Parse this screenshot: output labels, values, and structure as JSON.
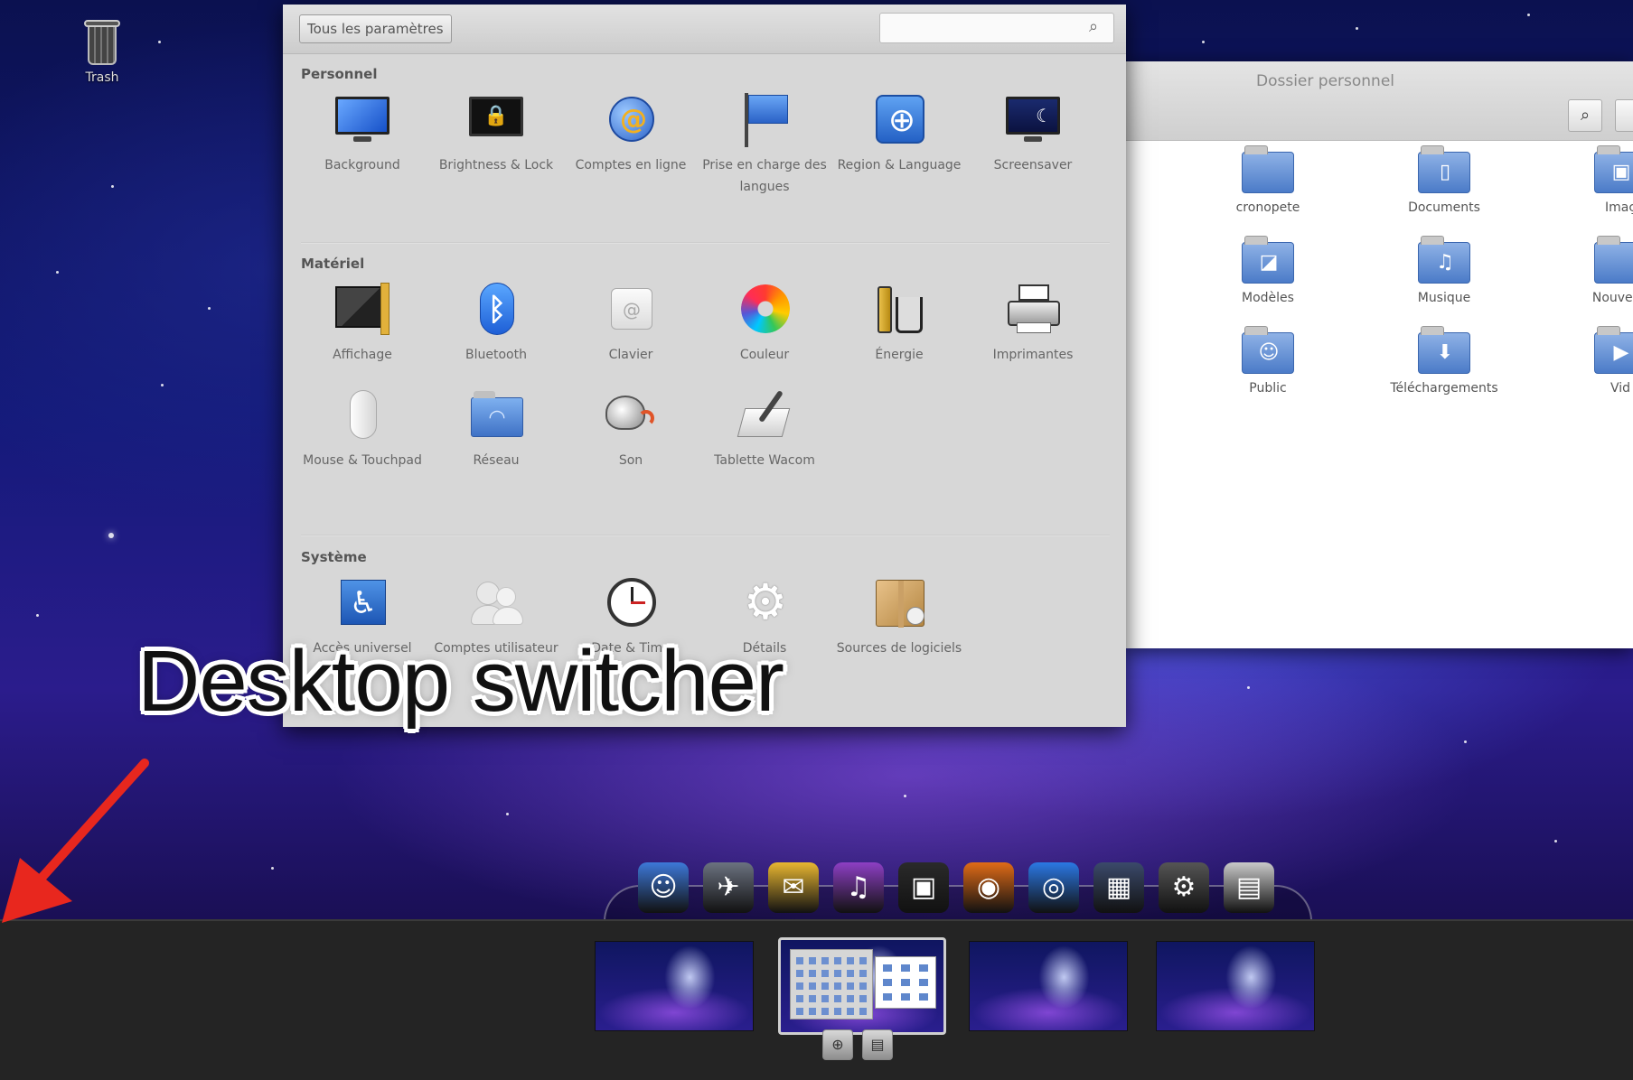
{
  "desktop": {
    "trash_label": "Trash"
  },
  "settings": {
    "all_settings_label": "Tous les paramètres",
    "search_placeholder": "",
    "sections": [
      {
        "title": "Personnel",
        "items": [
          {
            "label": "Background",
            "icon": "wallpaper-icon"
          },
          {
            "label": "Brightness & Lock",
            "icon": "brightness-lock-icon"
          },
          {
            "label": "Comptes en ligne",
            "icon": "online-accounts-icon"
          },
          {
            "label": "Prise en charge des langues",
            "icon": "language-support-icon"
          },
          {
            "label": "Region & Language",
            "icon": "region-language-icon"
          },
          {
            "label": "Screensaver",
            "icon": "screensaver-icon"
          }
        ]
      },
      {
        "title": "Matériel",
        "items": [
          {
            "label": "Affichage",
            "icon": "display-icon"
          },
          {
            "label": "Bluetooth",
            "icon": "bluetooth-icon"
          },
          {
            "label": "Clavier",
            "icon": "keyboard-icon"
          },
          {
            "label": "Couleur",
            "icon": "color-icon"
          },
          {
            "label": "Énergie",
            "icon": "power-icon"
          },
          {
            "label": "Imprimantes",
            "icon": "printer-icon"
          },
          {
            "label": "Mouse & Touchpad",
            "icon": "mouse-icon"
          },
          {
            "label": "Réseau",
            "icon": "network-icon"
          },
          {
            "label": "Son",
            "icon": "sound-icon"
          },
          {
            "label": "Tablette Wacom",
            "icon": "tablet-icon"
          }
        ]
      },
      {
        "title": "Système",
        "items": [
          {
            "label": "Accès universel",
            "icon": "accessibility-icon"
          },
          {
            "label": "Comptes utilisateur",
            "icon": "user-accounts-icon"
          },
          {
            "label": "Date & Time",
            "icon": "clock-icon"
          },
          {
            "label": "Détails",
            "icon": "gear-icon"
          },
          {
            "label": "Sources de logiciels",
            "icon": "software-sources-icon"
          }
        ]
      }
    ]
  },
  "files": {
    "title": "Dossier personnel",
    "folders": [
      {
        "label": "cronopete",
        "icon": "folder-icon"
      },
      {
        "label": "Documents",
        "icon": "folder-documents-icon"
      },
      {
        "label": "Imaç",
        "icon": "folder-pictures-icon"
      },
      {
        "label": "Modèles",
        "icon": "folder-templates-icon"
      },
      {
        "label": "Musique",
        "icon": "folder-music-icon"
      },
      {
        "label": "Nouveau",
        "icon": "folder-icon"
      },
      {
        "label": "Public",
        "icon": "folder-public-icon"
      },
      {
        "label": "Téléchargements",
        "icon": "folder-download-icon"
      },
      {
        "label": "Vid",
        "icon": "folder-videos-icon"
      }
    ]
  },
  "dock": {
    "items": [
      {
        "name": "finder-icon",
        "glyph": "☺",
        "color": "#3d78d8"
      },
      {
        "name": "rocket-icon",
        "glyph": "✈",
        "color": "#6b7280"
      },
      {
        "name": "mail-icon",
        "glyph": "✉",
        "color": "#e8b631"
      },
      {
        "name": "music-player-icon",
        "glyph": "♫",
        "color": "#8d3fc4"
      },
      {
        "name": "terminal-icon",
        "glyph": "▣",
        "color": "#2a2a2a"
      },
      {
        "name": "firefox-icon",
        "glyph": "◉",
        "color": "#e06b17"
      },
      {
        "name": "browser-icon",
        "glyph": "◎",
        "color": "#2b78e4"
      },
      {
        "name": "app-grid-icon",
        "glyph": "▦",
        "color": "#3b4a6b"
      },
      {
        "name": "settings-gear-icon",
        "glyph": "⚙",
        "color": "#555555"
      },
      {
        "name": "files-icon",
        "glyph": "▤",
        "color": "#c9c9c9"
      }
    ]
  },
  "workspaces": {
    "count": 4,
    "active_index": 1,
    "buttons": [
      {
        "name": "workspace-add-icon",
        "glyph": "⊕"
      },
      {
        "name": "workspace-files-icon",
        "glyph": "▤"
      }
    ]
  },
  "annotation": {
    "text": "Desktop switcher",
    "arrow_color": "#e8271e"
  }
}
